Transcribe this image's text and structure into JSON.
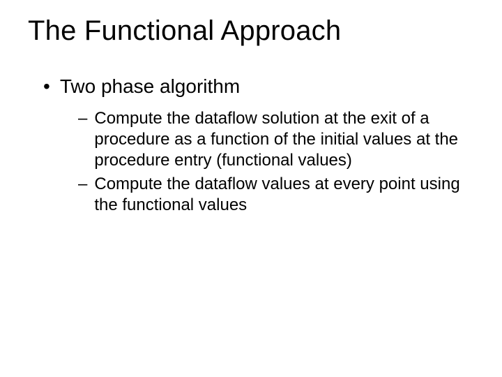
{
  "slide": {
    "title": "The Functional Approach",
    "bullet1": {
      "marker": "•",
      "text": "Two phase algorithm"
    },
    "sub1": {
      "marker": "–",
      "text": "Compute the dataflow solution at the exit of a procedure as a function of the initial values at the procedure entry (functional values)"
    },
    "sub2": {
      "marker": "–",
      "text": "Compute the dataflow values at every point using the functional values"
    }
  }
}
